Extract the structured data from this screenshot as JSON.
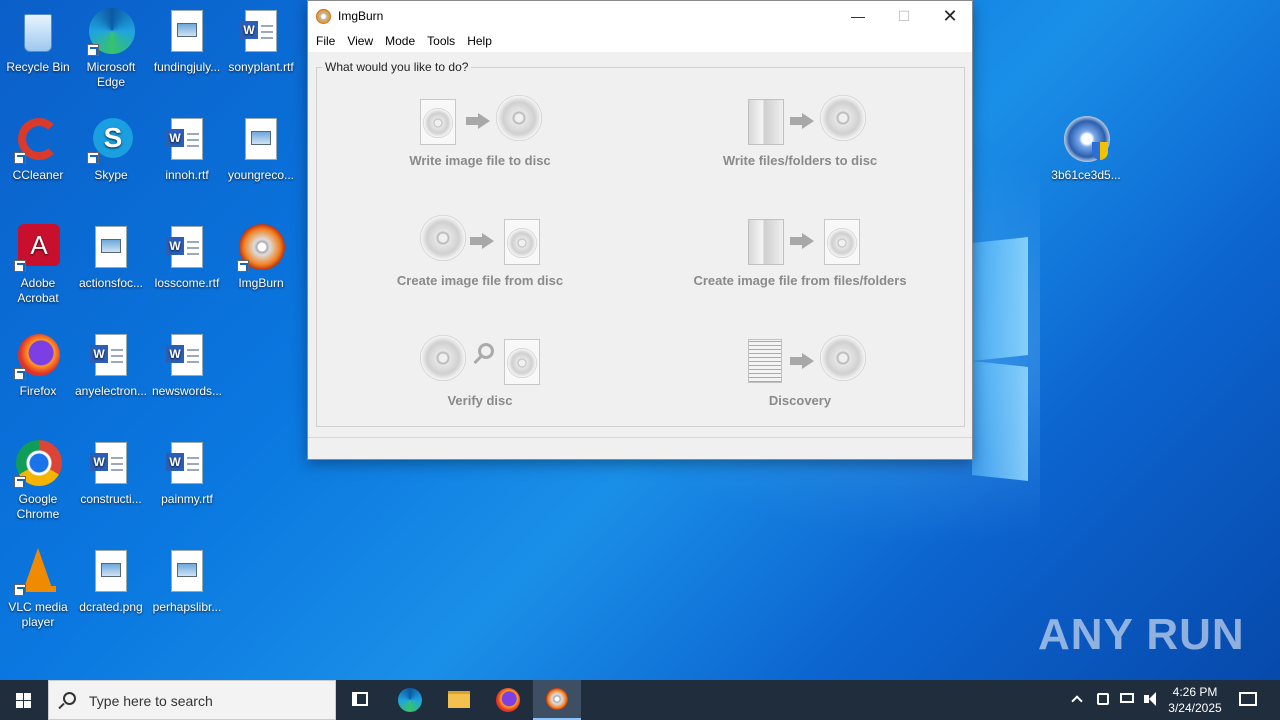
{
  "desktop": {
    "icons": [
      {
        "label": "Recycle Bin"
      },
      {
        "label": "Microsoft Edge"
      },
      {
        "label": "fundingjuly..."
      },
      {
        "label": "sonyplant.rtf"
      },
      {
        "label": "CCleaner"
      },
      {
        "label": "Skype"
      },
      {
        "label": "innoh.rtf"
      },
      {
        "label": "youngreco..."
      },
      {
        "label": "Adobe Acrobat"
      },
      {
        "label": "actionsfoc..."
      },
      {
        "label": "losscome.rtf"
      },
      {
        "label": "ImgBurn"
      },
      {
        "label": "Firefox"
      },
      {
        "label": "anyelectron..."
      },
      {
        "label": "newswords..."
      },
      {
        "label": "Google Chrome"
      },
      {
        "label": "constructi..."
      },
      {
        "label": "painmy.rtf"
      },
      {
        "label": "VLC media player"
      },
      {
        "label": "dcrated.png"
      },
      {
        "label": "perhapslibr..."
      },
      {
        "label": "3b61ce3d5..."
      }
    ]
  },
  "window": {
    "title": "ImgBurn",
    "menu": [
      "File",
      "View",
      "Mode",
      "Tools",
      "Help"
    ],
    "panel_caption": "What would you like to do?",
    "actions": [
      {
        "label": "Write image file to disc"
      },
      {
        "label": "Write files/folders to disc"
      },
      {
        "label": "Create image file from disc"
      },
      {
        "label": "Create image file from files/folders"
      },
      {
        "label": "Verify disc"
      },
      {
        "label": "Discovery"
      }
    ]
  },
  "taskbar": {
    "search_placeholder": "Type here to search",
    "time": "4:26 PM",
    "date": "3/24/2025"
  },
  "watermark": "ANY RUN"
}
